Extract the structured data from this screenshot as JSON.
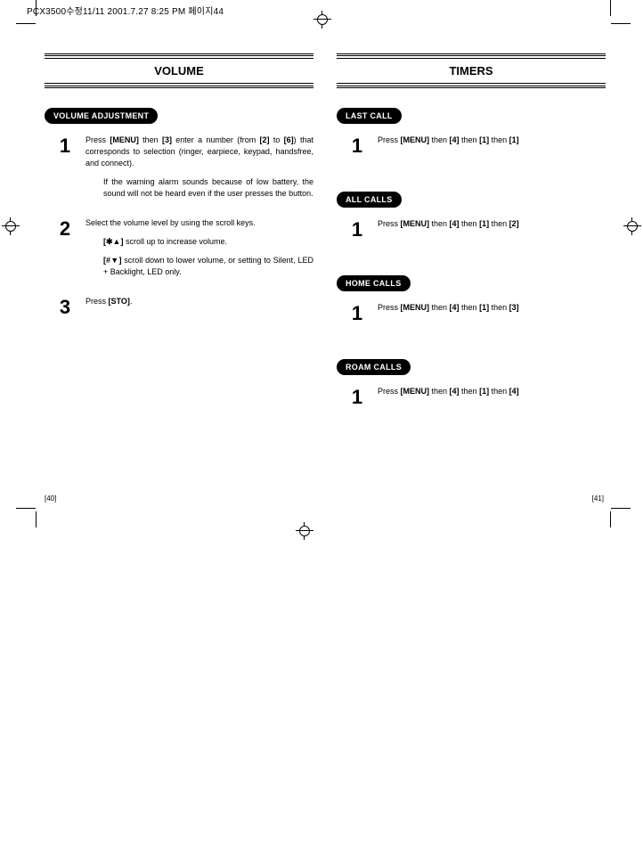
{
  "header_line": "PCX3500수정11/11  2001.7.27 8:25 PM  페이지44",
  "left": {
    "title": "VOLUME",
    "section1": {
      "pill": "VOLUME ADJUSTMENT",
      "step1_num": "1",
      "step1_p1_a": "Press ",
      "step1_p1_b": "[MENU]",
      "step1_p1_c": " then ",
      "step1_p1_d": "[3]",
      "step1_p1_e": " enter a number (from ",
      "step1_p1_f": "[2]",
      "step1_p1_g": " to ",
      "step1_p1_h": "[6]",
      "step1_p1_i": ") that corresponds to selection (ringer, earpiece, keypad, handsfree, and connect).",
      "step1_p2": "If the warning alarm sounds because of low battery, the sound will not be heard even if the user presses the button.",
      "step2_num": "2",
      "step2_p1": "Select the volume level by using the scroll keys.",
      "step2_p2_a": "[✱▲]",
      "step2_p2_b": " scroll up to increase volume.",
      "step2_p3_a": "[#▼]",
      "step2_p3_b": " scroll down to lower volume, or setting to Silent, LED + Backlight, LED only.",
      "step3_num": "3",
      "step3_a": "Press ",
      "step3_b": "[STO]",
      "step3_c": "."
    },
    "pagenum": "[40]"
  },
  "right": {
    "title": "TIMERS",
    "sec_last": {
      "pill": "LAST CALL",
      "num": "1",
      "a": "Press ",
      "b": "[MENU]",
      "c": " then ",
      "d": "[4]",
      "e": " then ",
      "f": "[1]",
      "g": " then ",
      "h": "[1]"
    },
    "sec_all": {
      "pill": "ALL CALLS",
      "num": "1",
      "a": "Press ",
      "b": "[MENU]",
      "c": " then ",
      "d": "[4]",
      "e": " then ",
      "f": "[1]",
      "g": " then ",
      "h": "[2]"
    },
    "sec_home": {
      "pill": "HOME CALLS",
      "num": "1",
      "a": "Press ",
      "b": "[MENU]",
      "c": " then ",
      "d": "[4]",
      "e": " then ",
      "f": "[1]",
      "g": " then ",
      "h": "[3]"
    },
    "sec_roam": {
      "pill": "ROAM CALLS",
      "num": "1",
      "a": "Press ",
      "b": "[MENU]",
      "c": " then ",
      "d": "[4]",
      "e": " then ",
      "f": "[1]",
      "g": " then ",
      "h": "[4]"
    },
    "pagenum": "[41]"
  }
}
